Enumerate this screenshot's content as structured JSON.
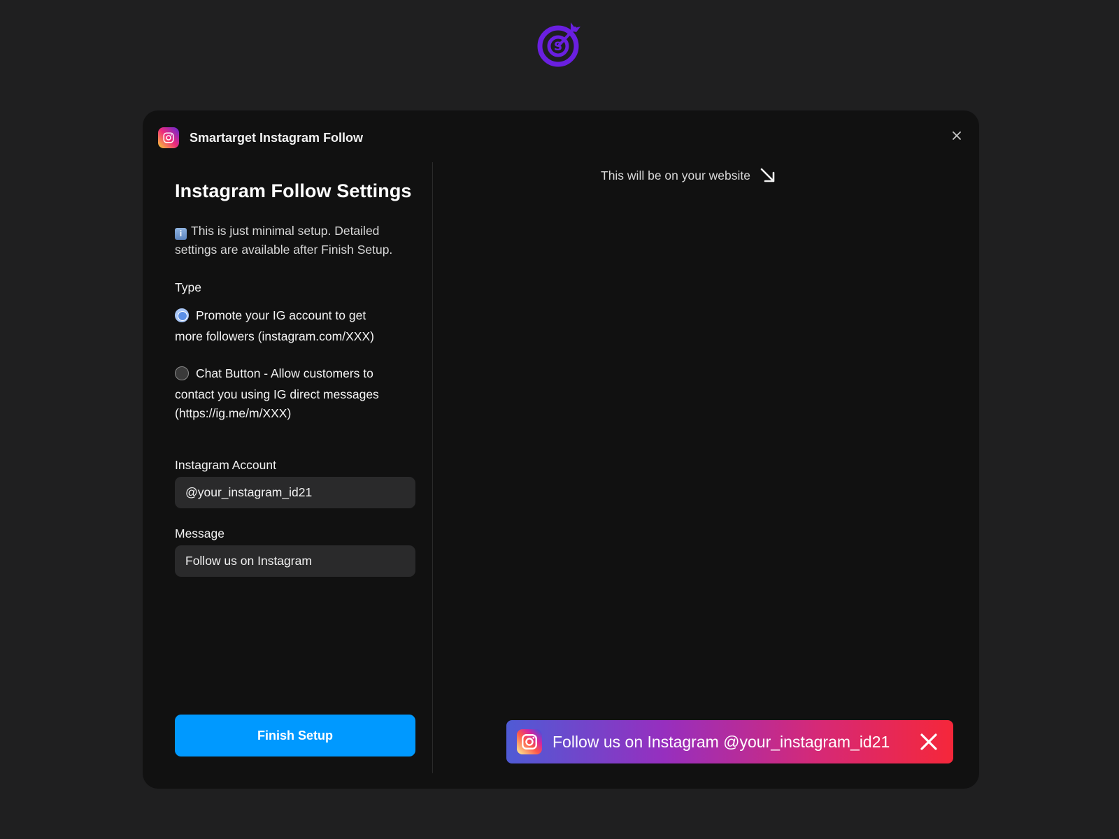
{
  "header": {
    "app_title": "Smartarget Instagram Follow"
  },
  "settings": {
    "title": "Instagram Follow Settings",
    "info_text": "This is just minimal setup. Detailed settings are available after Finish Setup.",
    "type_label": "Type",
    "options": [
      {
        "line1": "Promote your IG account to get",
        "rest": "more followers (instagram.com/XXX)",
        "selected": true
      },
      {
        "line1": "Chat Button - Allow customers to",
        "rest": "contact you using IG direct messages (https://ig.me/m/XXX)",
        "selected": false
      }
    ],
    "account_label": "Instagram Account",
    "account_value": "@your_instagram_id21",
    "message_label": "Message",
    "message_value": "Follow us on Instagram",
    "finish_label": "Finish Setup"
  },
  "preview": {
    "caption": "This will be on your website",
    "bar_text": "Follow us on Instagram @your_instagram_id21"
  },
  "colors": {
    "accent": "#0099ff",
    "brand_purple": "#6a1fe0",
    "background": "#1f1f20",
    "modal": "#111111"
  },
  "icons": {
    "logo": "target-s-icon",
    "app": "instagram-icon",
    "close": "close-icon",
    "info": "info-icon",
    "arrow": "arrow-down-right-icon"
  }
}
